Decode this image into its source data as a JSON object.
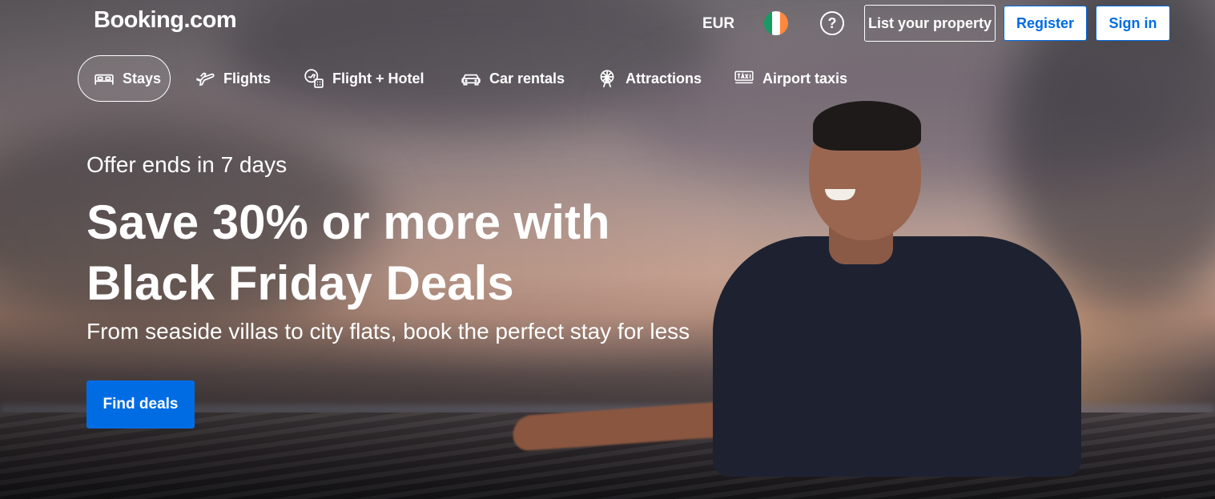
{
  "header": {
    "logo": "Booking.com",
    "currency": "EUR",
    "flag_icon": "ireland-flag-icon",
    "flag_colors": [
      "#169b62",
      "#ffffff",
      "#ff883e"
    ],
    "help_icon": "question-circle-icon",
    "help_symbol": "?",
    "list_property_label": "List your property",
    "register_label": "Register",
    "signin_label": "Sign in"
  },
  "nav": {
    "items": [
      {
        "label": "Stays",
        "icon": "bed-icon",
        "active": true
      },
      {
        "label": "Flights",
        "icon": "plane-icon",
        "active": false
      },
      {
        "label": "Flight + Hotel",
        "icon": "flight-hotel-icon",
        "active": false
      },
      {
        "label": "Car rentals",
        "icon": "car-icon",
        "active": false
      },
      {
        "label": "Attractions",
        "icon": "ferris-wheel-icon",
        "active": false
      },
      {
        "label": "Airport taxis",
        "icon": "taxi-icon",
        "active": false
      }
    ]
  },
  "hero": {
    "offer": "Offer ends in 7 days",
    "headline": "Save 30% or more with Black Friday Deals",
    "subline": "From seaside villas to city flats, book the perfect stay for less",
    "cta_label": "Find deals",
    "background": "sunset-sea-surfers-photo"
  },
  "colors": {
    "accent": "#006ce4",
    "text": "#ffffff"
  }
}
